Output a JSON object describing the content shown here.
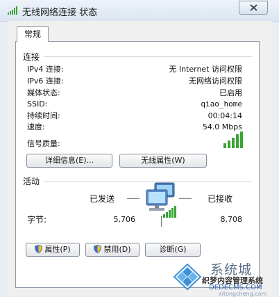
{
  "window": {
    "title": "无线网络连接 状态"
  },
  "tabs": [
    {
      "label": "常规"
    }
  ],
  "connection": {
    "heading": "连接",
    "rows": [
      {
        "label": "IPv4 连接:",
        "value": "无 Internet 访问权限"
      },
      {
        "label": "IPv6 连接:",
        "value": "无网络访问权限"
      },
      {
        "label": "媒体状态:",
        "value": "已启用"
      },
      {
        "label": "SSID:",
        "value": "qiao_home"
      },
      {
        "label": "持续时间:",
        "value": "00:04:14"
      },
      {
        "label": "速度:",
        "value": "54.0 Mbps"
      }
    ],
    "signal_label": "信号质量:",
    "signal_bars": 5,
    "details_button": "详细信息(E)...",
    "wireless_props_button": "无线属性(W)"
  },
  "activity": {
    "heading": "活动",
    "sent_label": "已发送",
    "received_label": "已接收",
    "bytes_label": "字节:",
    "bytes_sent": "5,706",
    "bytes_received": "8,708"
  },
  "buttons": {
    "properties": "属性(P)",
    "disable": "禁用(D)",
    "diagnose": "诊断(G)"
  },
  "watermark": {
    "line1": "系统城",
    "line2": "织梦内容管理系统",
    "line3": "DEDECMS.COM",
    "line4": "xitongcheng.com"
  },
  "colors": {
    "signal_green": "#3aa436",
    "title_bg": "#dbe5f1",
    "panel_border": "#8e98a6"
  }
}
